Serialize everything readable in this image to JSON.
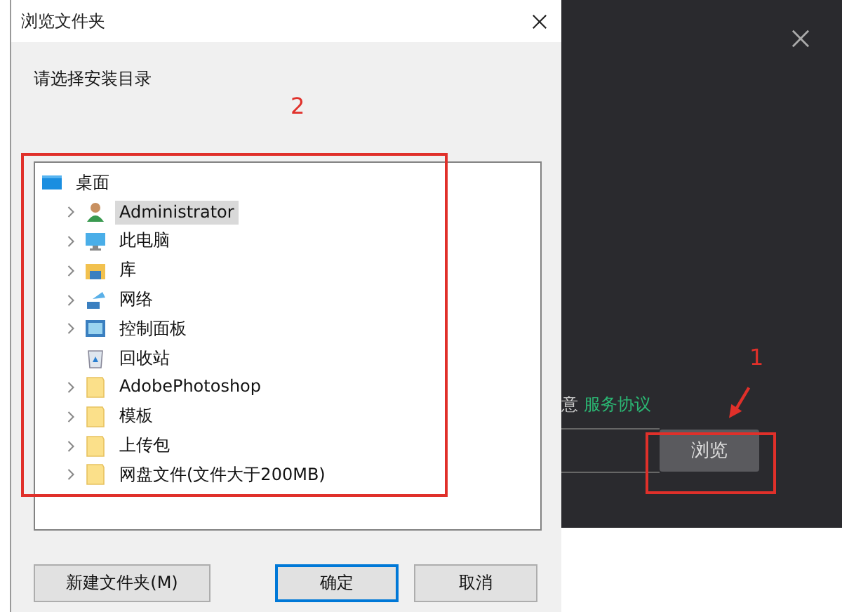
{
  "dialog": {
    "title": "浏览文件夹",
    "prompt": "请选择安装目录",
    "tree": [
      {
        "label": "桌面",
        "kind": "desktop",
        "expandable": false,
        "selected": false,
        "children": [
          {
            "label": "Administrator",
            "kind": "user",
            "expandable": true,
            "selected": true
          },
          {
            "label": "此电脑",
            "kind": "computer",
            "expandable": true,
            "selected": false
          },
          {
            "label": "库",
            "kind": "library",
            "expandable": true,
            "selected": false
          },
          {
            "label": "网络",
            "kind": "network",
            "expandable": true,
            "selected": false
          },
          {
            "label": "控制面板",
            "kind": "control-panel",
            "expandable": true,
            "selected": false
          },
          {
            "label": "回收站",
            "kind": "recycle-bin",
            "expandable": false,
            "selected": false
          },
          {
            "label": "AdobePhotoshop",
            "kind": "folder",
            "expandable": true,
            "selected": false
          },
          {
            "label": "模板",
            "kind": "folder",
            "expandable": true,
            "selected": false
          },
          {
            "label": "上传包",
            "kind": "folder",
            "expandable": true,
            "selected": false
          },
          {
            "label": "网盘文件(文件大于200MB)",
            "kind": "folder",
            "expandable": true,
            "selected": false
          }
        ]
      }
    ],
    "buttons": [
      {
        "label": "新建文件夹(M)",
        "default": false
      },
      {
        "label": "确定",
        "default": true
      },
      {
        "label": "取消",
        "default": false
      }
    ]
  },
  "installer": {
    "agree_text": "意",
    "agreement_link": "服务协议",
    "browse_button": "浏览"
  },
  "annotations": [
    {
      "label": "2"
    },
    {
      "label": "1"
    }
  ]
}
